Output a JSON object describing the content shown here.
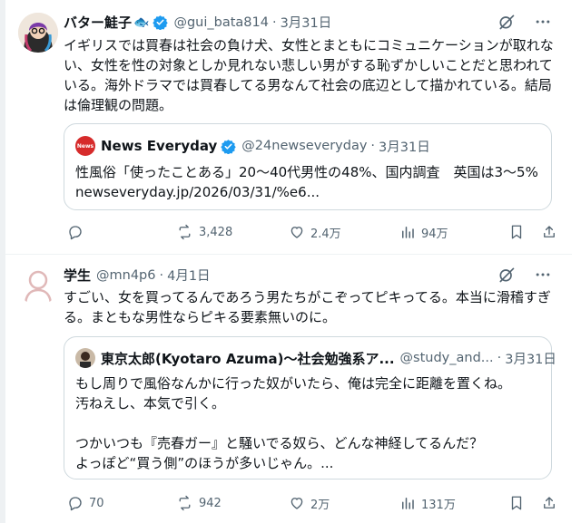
{
  "tweets": [
    {
      "display_name": "バター鮭子",
      "name_emoji": "🐟",
      "handle": "@gui_bata814",
      "separator": "·",
      "date": "3月31日",
      "text": "イギリスでは買春は社会の負け犬、女性とまともにコミュニケーションが取れない、女性を性の対象としか見れない悲しい男がする恥ずかしいことだと思われている。海外ドラマでは買春してる男なんて社会の底辺として描かれている。結局は倫理観の問題。",
      "quote": {
        "logo_text": "News",
        "display_name": "News Everyday",
        "handle": "@24newseveryday",
        "separator": "·",
        "date": "3月31日",
        "text": "性風俗「使ったことある」20～40代男性の48%、国内調査　英国は3～5%",
        "url": "newseveryday.jp/2026/03/31/%e6..."
      },
      "stats": {
        "replies": "",
        "reposts": "3,428",
        "likes": "2.4万",
        "views": "94万"
      }
    },
    {
      "display_name": "学生",
      "handle": "@mn4p6",
      "separator": "·",
      "date": "4月1日",
      "text": "すごい、女を買ってるんであろう男たちがこぞってピキってる。本当に滑稽すぎる。まともな男性ならピキる要素無いのに。",
      "quote": {
        "display_name": "東京太郎(Kyotaro Azuma)〜社会勉強系ア...",
        "handle": "@study_and...",
        "separator": "·",
        "date": "3月31日",
        "lines": [
          "もし周りで風俗なんかに行った奴がいたら、俺は完全に距離を置くね。",
          "汚ねえし、本気で引く。",
          "つかいつも『売春ガー』と騒いでる奴ら、どんな神経してるんだ？",
          "よっぽど“買う側”のほうが多いじゃん。..."
        ]
      },
      "stats": {
        "replies": "70",
        "reposts": "942",
        "likes": "2万",
        "views": "131万"
      }
    }
  ],
  "icons": {
    "verified": "verified-badge-icon",
    "grok": "grok-icon",
    "more": "more-icon",
    "reply": "reply-icon",
    "repost": "repost-icon",
    "like": "like-icon",
    "views": "views-icon",
    "bookmark": "bookmark-icon",
    "share": "share-icon"
  },
  "colors": {
    "verified_blue": "#1d9bf0",
    "muted": "#536471",
    "news_red": "#d62b2b",
    "border": "#cfd9de"
  }
}
